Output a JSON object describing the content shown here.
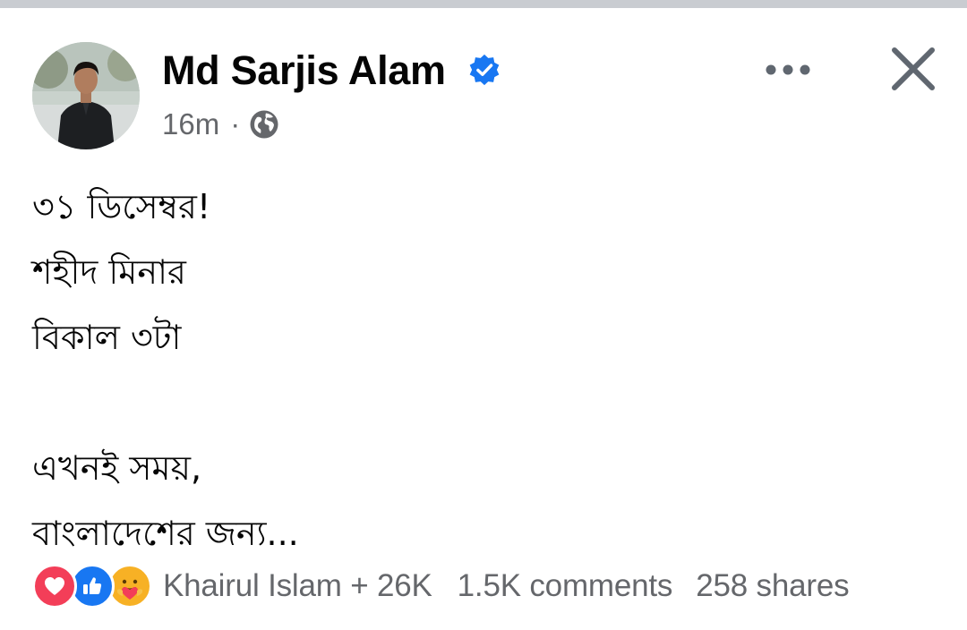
{
  "post": {
    "author": {
      "name": "Md Sarjis Alam",
      "verified": true
    },
    "time": "16m",
    "separator": "·",
    "audience_icon": "globe-icon",
    "lines": [
      "৩১ ডিসেম্বর!",
      "শহীদ মিনার",
      "বিকাল ৩টা",
      "",
      "এখনই সময়,",
      "বাংলাদেশের জন্য..."
    ]
  },
  "header_actions": {
    "more_icon": "more-horizontal-icon",
    "close_icon": "close-icon"
  },
  "footer": {
    "reactions": [
      "love",
      "like",
      "care"
    ],
    "reacted_by": "Khairul Islam + 26K",
    "comments": "1.5K comments",
    "shares": "258 shares"
  },
  "colors": {
    "brand_blue": "#1877f2",
    "secondary_text": "#65676b",
    "primary_text": "#050505",
    "love_red": "#f33e58",
    "care_yellow": "#f7b125"
  }
}
